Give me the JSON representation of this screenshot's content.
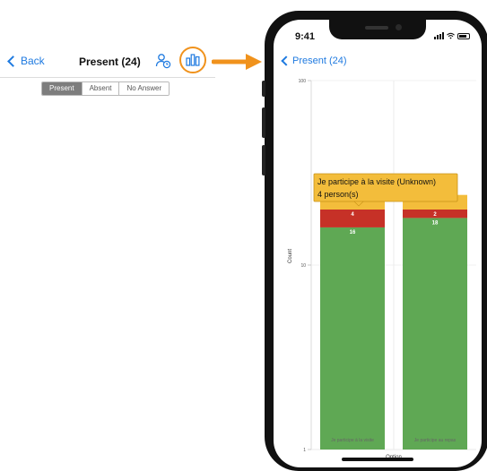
{
  "left_screen": {
    "back_label": "Back",
    "title": "Present (24)",
    "segments": [
      {
        "label": "Present",
        "active": true
      },
      {
        "label": "Absent",
        "active": false
      },
      {
        "label": "No Answer",
        "active": false
      }
    ],
    "icons": {
      "user": "user-clock-icon",
      "chart": "bar-chart-icon"
    }
  },
  "phone": {
    "time": "9:41",
    "nav_back_label": "Present (24)",
    "status_icons": [
      "signal-icon",
      "wifi-icon",
      "battery-icon"
    ]
  },
  "colors": {
    "accent": "#1f7ae0",
    "highlight": "#f0921c",
    "green": "#5fa854",
    "red": "#c63127",
    "yellow": "#f3bd3b"
  },
  "chart_data": {
    "type": "bar",
    "stacked": true,
    "categories": [
      "Je participe à la visite",
      "Je participe au repas"
    ],
    "series": [
      {
        "values": [
          16,
          18
        ],
        "color": "#5fa854"
      },
      {
        "values": [
          4,
          2
        ],
        "color": "#c63127"
      },
      {
        "values": [
          4,
          4
        ],
        "color": "#f3bd3b"
      }
    ],
    "xlabel": "Option",
    "ylabel": "Count",
    "yticks": [
      1,
      10,
      100
    ],
    "ylim": [
      1,
      100
    ],
    "yscale": "log",
    "grid": true,
    "tooltip": {
      "line1": "Je participe à la visite  (Unknown)",
      "line2": "4 person(s)"
    }
  }
}
